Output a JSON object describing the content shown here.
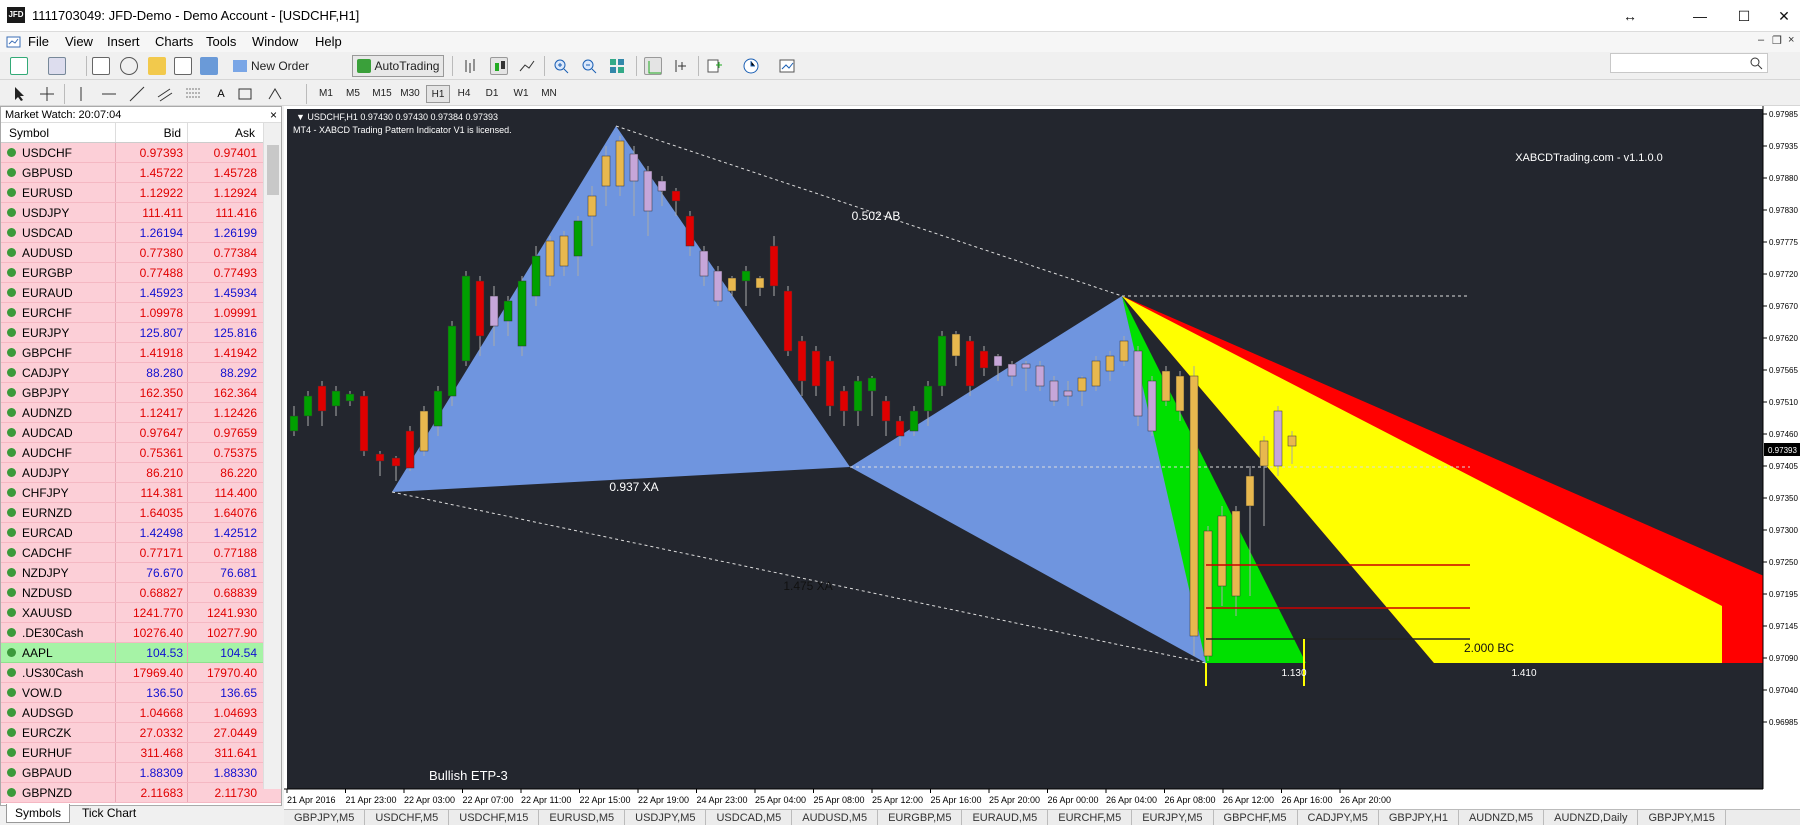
{
  "window": {
    "title": "1111703049: JFD-Demo - Demo Account - [USDCHF,H1]",
    "app_logo": "JFD",
    "restore_glyph": "↔",
    "min_glyph": "—",
    "max_glyph": "☐",
    "close_glyph": "✕"
  },
  "menu": [
    "File",
    "View",
    "Insert",
    "Charts",
    "Tools",
    "Window",
    "Help"
  ],
  "toolbar": {
    "new_order": "New Order",
    "autotrading": "AutoTrading",
    "timeframes": [
      "M1",
      "M5",
      "M15",
      "M30",
      "H1",
      "H4",
      "D1",
      "W1",
      "MN"
    ],
    "active_tf": "H1"
  },
  "market_watch": {
    "title": "Market Watch: 20:07:04",
    "close_glyph": "×",
    "columns": [
      "Symbol",
      "Bid",
      "Ask"
    ],
    "rows": [
      {
        "symbol": "USDCHF",
        "bid": "0.97393",
        "ask": "0.97401",
        "color": "red"
      },
      {
        "symbol": "GBPUSD",
        "bid": "1.45722",
        "ask": "1.45728",
        "color": "red"
      },
      {
        "symbol": "EURUSD",
        "bid": "1.12922",
        "ask": "1.12924",
        "color": "red"
      },
      {
        "symbol": "USDJPY",
        "bid": "111.411",
        "ask": "111.416",
        "color": "red"
      },
      {
        "symbol": "USDCAD",
        "bid": "1.26194",
        "ask": "1.26199",
        "color": "blue"
      },
      {
        "symbol": "AUDUSD",
        "bid": "0.77380",
        "ask": "0.77384",
        "color": "red"
      },
      {
        "symbol": "EURGBP",
        "bid": "0.77488",
        "ask": "0.77493",
        "color": "red"
      },
      {
        "symbol": "EURAUD",
        "bid": "1.45923",
        "ask": "1.45934",
        "color": "blue"
      },
      {
        "symbol": "EURCHF",
        "bid": "1.09978",
        "ask": "1.09991",
        "color": "red"
      },
      {
        "symbol": "EURJPY",
        "bid": "125.807",
        "ask": "125.816",
        "color": "blue"
      },
      {
        "symbol": "GBPCHF",
        "bid": "1.41918",
        "ask": "1.41942",
        "color": "red"
      },
      {
        "symbol": "CADJPY",
        "bid": "88.280",
        "ask": "88.292",
        "color": "blue"
      },
      {
        "symbol": "GBPJPY",
        "bid": "162.350",
        "ask": "162.364",
        "color": "red"
      },
      {
        "symbol": "AUDNZD",
        "bid": "1.12417",
        "ask": "1.12426",
        "color": "red"
      },
      {
        "symbol": "AUDCAD",
        "bid": "0.97647",
        "ask": "0.97659",
        "color": "red"
      },
      {
        "symbol": "AUDCHF",
        "bid": "0.75361",
        "ask": "0.75375",
        "color": "red"
      },
      {
        "symbol": "AUDJPY",
        "bid": "86.210",
        "ask": "86.220",
        "color": "red"
      },
      {
        "symbol": "CHFJPY",
        "bid": "114.381",
        "ask": "114.400",
        "color": "red"
      },
      {
        "symbol": "EURNZD",
        "bid": "1.64035",
        "ask": "1.64076",
        "color": "red"
      },
      {
        "symbol": "EURCAD",
        "bid": "1.42498",
        "ask": "1.42512",
        "color": "blue"
      },
      {
        "symbol": "CADCHF",
        "bid": "0.77171",
        "ask": "0.77188",
        "color": "red"
      },
      {
        "symbol": "NZDJPY",
        "bid": "76.670",
        "ask": "76.681",
        "color": "blue"
      },
      {
        "symbol": "NZDUSD",
        "bid": "0.68827",
        "ask": "0.68839",
        "color": "red"
      },
      {
        "symbol": "XAUUSD",
        "bid": "1241.770",
        "ask": "1241.930",
        "color": "red"
      },
      {
        "symbol": ".DE30Cash",
        "bid": "10276.40",
        "ask": "10277.90",
        "color": "red"
      },
      {
        "symbol": "AAPL",
        "bid": "104.53",
        "ask": "104.54",
        "color": "blue",
        "highlight": "green"
      },
      {
        "symbol": ".US30Cash",
        "bid": "17969.40",
        "ask": "17970.40",
        "color": "red"
      },
      {
        "symbol": "VOW.D",
        "bid": "136.50",
        "ask": "136.65",
        "color": "blue"
      },
      {
        "symbol": "AUDSGD",
        "bid": "1.04668",
        "ask": "1.04693",
        "color": "red"
      },
      {
        "symbol": "EURCZK",
        "bid": "27.0332",
        "ask": "27.0449",
        "color": "red"
      },
      {
        "symbol": "EURHUF",
        "bid": "311.468",
        "ask": "311.641",
        "color": "red"
      },
      {
        "symbol": "GBPAUD",
        "bid": "1.88309",
        "ask": "1.88330",
        "color": "blue"
      },
      {
        "symbol": "GBPNZD",
        "bid": "2.11683",
        "ask": "2.11730",
        "color": "red"
      }
    ],
    "tabs": [
      "Symbols",
      "Tick Chart"
    ]
  },
  "chart": {
    "header": "USDCHF,H1  0.97430 0.97430 0.97384 0.97393",
    "license_text": "MT4 - XABCD Trading Pattern Indicator V1 is licensed.",
    "watermark": "XABCDTrading.com - v1.1.0.0",
    "pattern_label": "Bullish ETP-3",
    "labels": {
      "ab": "0.502 AB",
      "xa": "0.937 XA",
      "xa2": "1.475 XA",
      "bc": "2.000 BC",
      "ext1": "1.130",
      "ext2": "1.410"
    },
    "price_axis": [
      "0.97985",
      "0.97935",
      "0.97880",
      "0.97830",
      "0.97775",
      "0.97720",
      "0.97670",
      "0.97620",
      "0.97565",
      "0.97510",
      "0.97460",
      "0.97405",
      "0.97393",
      "0.97350",
      "0.97300",
      "0.97250",
      "0.97195",
      "0.97145",
      "0.97090",
      "0.97040",
      "0.96985"
    ],
    "time_axis": [
      "21 Apr 2016",
      "21 Apr 23:00",
      "22 Apr 03:00",
      "22 Apr 07:00",
      "22 Apr 11:00",
      "22 Apr 15:00",
      "22 Apr 19:00",
      "24 Apr 23:00",
      "25 Apr 04:00",
      "25 Apr 08:00",
      "25 Apr 12:00",
      "25 Apr 16:00",
      "25 Apr 20:00",
      "26 Apr 00:00",
      "26 Apr 04:00",
      "26 Apr 08:00",
      "26 Apr 12:00",
      "26 Apr 16:00",
      "26 Apr 20:00"
    ],
    "colors": {
      "bg": "#23262e",
      "bull": "#00a000",
      "bear": "#e00000",
      "triangle": "#6f95df",
      "red_zone": "#ff0000",
      "yellow_zone": "#ffff00",
      "green_zone": "#00e000",
      "tracking_candle_bull": "#e8b84e",
      "tracking_candle_bear": "#c6a6d9"
    }
  },
  "chart_tabs": [
    "GBPJPY,M5",
    "USDCHF,M5",
    "USDCHF,M15",
    "EURUSD,M5",
    "USDJPY,M5",
    "USDCAD,M5",
    "AUDUSD,M5",
    "EURGBP,M5",
    "EURAUD,M5",
    "EURCHF,M5",
    "EURJPY,M5",
    "GBPCHF,M5",
    "CADJPY,M5",
    "GBPJPY,H1",
    "AUDNZD,M5",
    "AUDNZD,Daily",
    "GBPJPY,M15"
  ]
}
